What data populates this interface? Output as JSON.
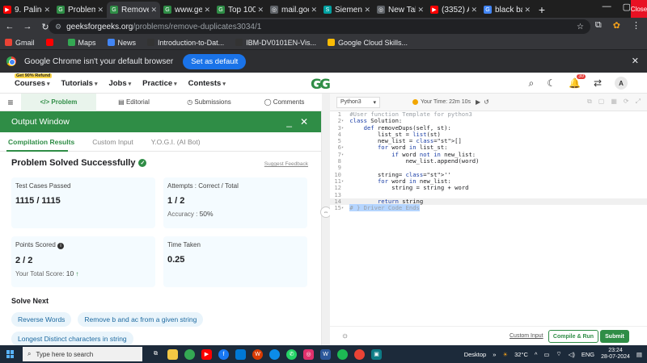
{
  "browser": {
    "tabs": [
      {
        "label": "9. Palindr",
        "color": "#ff0000",
        "glyph": "▶"
      },
      {
        "label": "Problem o",
        "color": "#2f8d46",
        "glyph": "G"
      },
      {
        "label": "Remove D",
        "color": "#2f8d46",
        "glyph": "G",
        "active": true
      },
      {
        "label": "www.geek",
        "color": "#2f8d46",
        "glyph": "G"
      },
      {
        "label": "Top 100 Li",
        "color": "#2f8d46",
        "glyph": "G"
      },
      {
        "label": "mail.goog",
        "color": "#5f6368",
        "glyph": "◎"
      },
      {
        "label": "Siemens C",
        "color": "#00a1a1",
        "glyph": "S"
      },
      {
        "label": "New Tab",
        "color": "#5f6368",
        "glyph": "◎"
      },
      {
        "label": "(3352) Ad",
        "color": "#ff0000",
        "glyph": "▶"
      },
      {
        "label": "black back",
        "color": "#4285f4",
        "glyph": "G"
      }
    ],
    "new_tab": "+",
    "window_close": "Close",
    "url_host": "geeksforgeeks.org",
    "url_path": "/problems/remove-duplicates3034/1",
    "bookmarks": [
      {
        "label": "Gmail",
        "color": "#ea4335"
      },
      {
        "label": "",
        "color": "#ff0000"
      },
      {
        "label": "Maps",
        "color": "#34a853"
      },
      {
        "label": "News",
        "color": "#4285f4"
      },
      {
        "label": "Introduction-to-Dat...",
        "color": "#333333"
      },
      {
        "label": "IBM-DV0101EN-Vis...",
        "color": "#333333"
      },
      {
        "label": "Google Cloud Skills...",
        "color": "#fbbc05"
      }
    ],
    "infobar_text": "Google Chrome isn't your default browser",
    "infobar_button": "Set as default"
  },
  "gfg": {
    "refund_badge": "Get 90% Refund",
    "menu": [
      "Courses",
      "Tutorials",
      "Jobs",
      "Practice",
      "Contests"
    ],
    "logo": "GG",
    "notif_count": "30",
    "avatar": "A"
  },
  "subbar": {
    "tabs": [
      "</> Problem",
      "Editorial",
      "Submissions",
      "Comments"
    ]
  },
  "output": {
    "title": "Output Window",
    "tabs": [
      "Compilation Results",
      "Custom Input",
      "Y.O.G.I. (AI Bot)"
    ],
    "status": "Problem Solved Successfully",
    "feedback": "Suggest Feedback",
    "cards": {
      "tests_title": "Test Cases Passed",
      "tests_value": "1115 / 1115",
      "attempts_title": "Attempts : Correct / Total",
      "attempts_value": "1 / 2",
      "accuracy_label": "Accuracy :",
      "accuracy_value": "50%",
      "points_title": "Points Scored",
      "points_value": "2 / 2",
      "total_label": "Your Total Score:",
      "total_value": "10",
      "time_title": "Time Taken",
      "time_value": "0.25"
    },
    "solve_next": "Solve Next",
    "chips": [
      "Reverse Words",
      "Remove b and ac from a given string",
      "Longest Distinct characters in string"
    ]
  },
  "editor": {
    "language": "Python3",
    "timer": "Your Time: 22m 10s",
    "custom_input": "Custom Input",
    "compile_run": "Compile & Run",
    "submit": "Submit",
    "code_lines": [
      "#User function Template for python3",
      "class Solution:",
      "    def removeDups(self, st):",
      "        list_st = list(st)",
      "        new_list = []",
      "        for word in list_st:",
      "            if word not in new_list:",
      "                new_list.append(word)",
      "",
      "        string= ''",
      "        for word in new_list:",
      "            string = string + word",
      "",
      "        return string",
      "# } Driver Code Ends"
    ]
  },
  "taskbar": {
    "search_placeholder": "Type here to search",
    "desktop": "Desktop",
    "weather": "32°C",
    "lang": "ENG",
    "time": "23:24",
    "date": "28-07-2024"
  }
}
